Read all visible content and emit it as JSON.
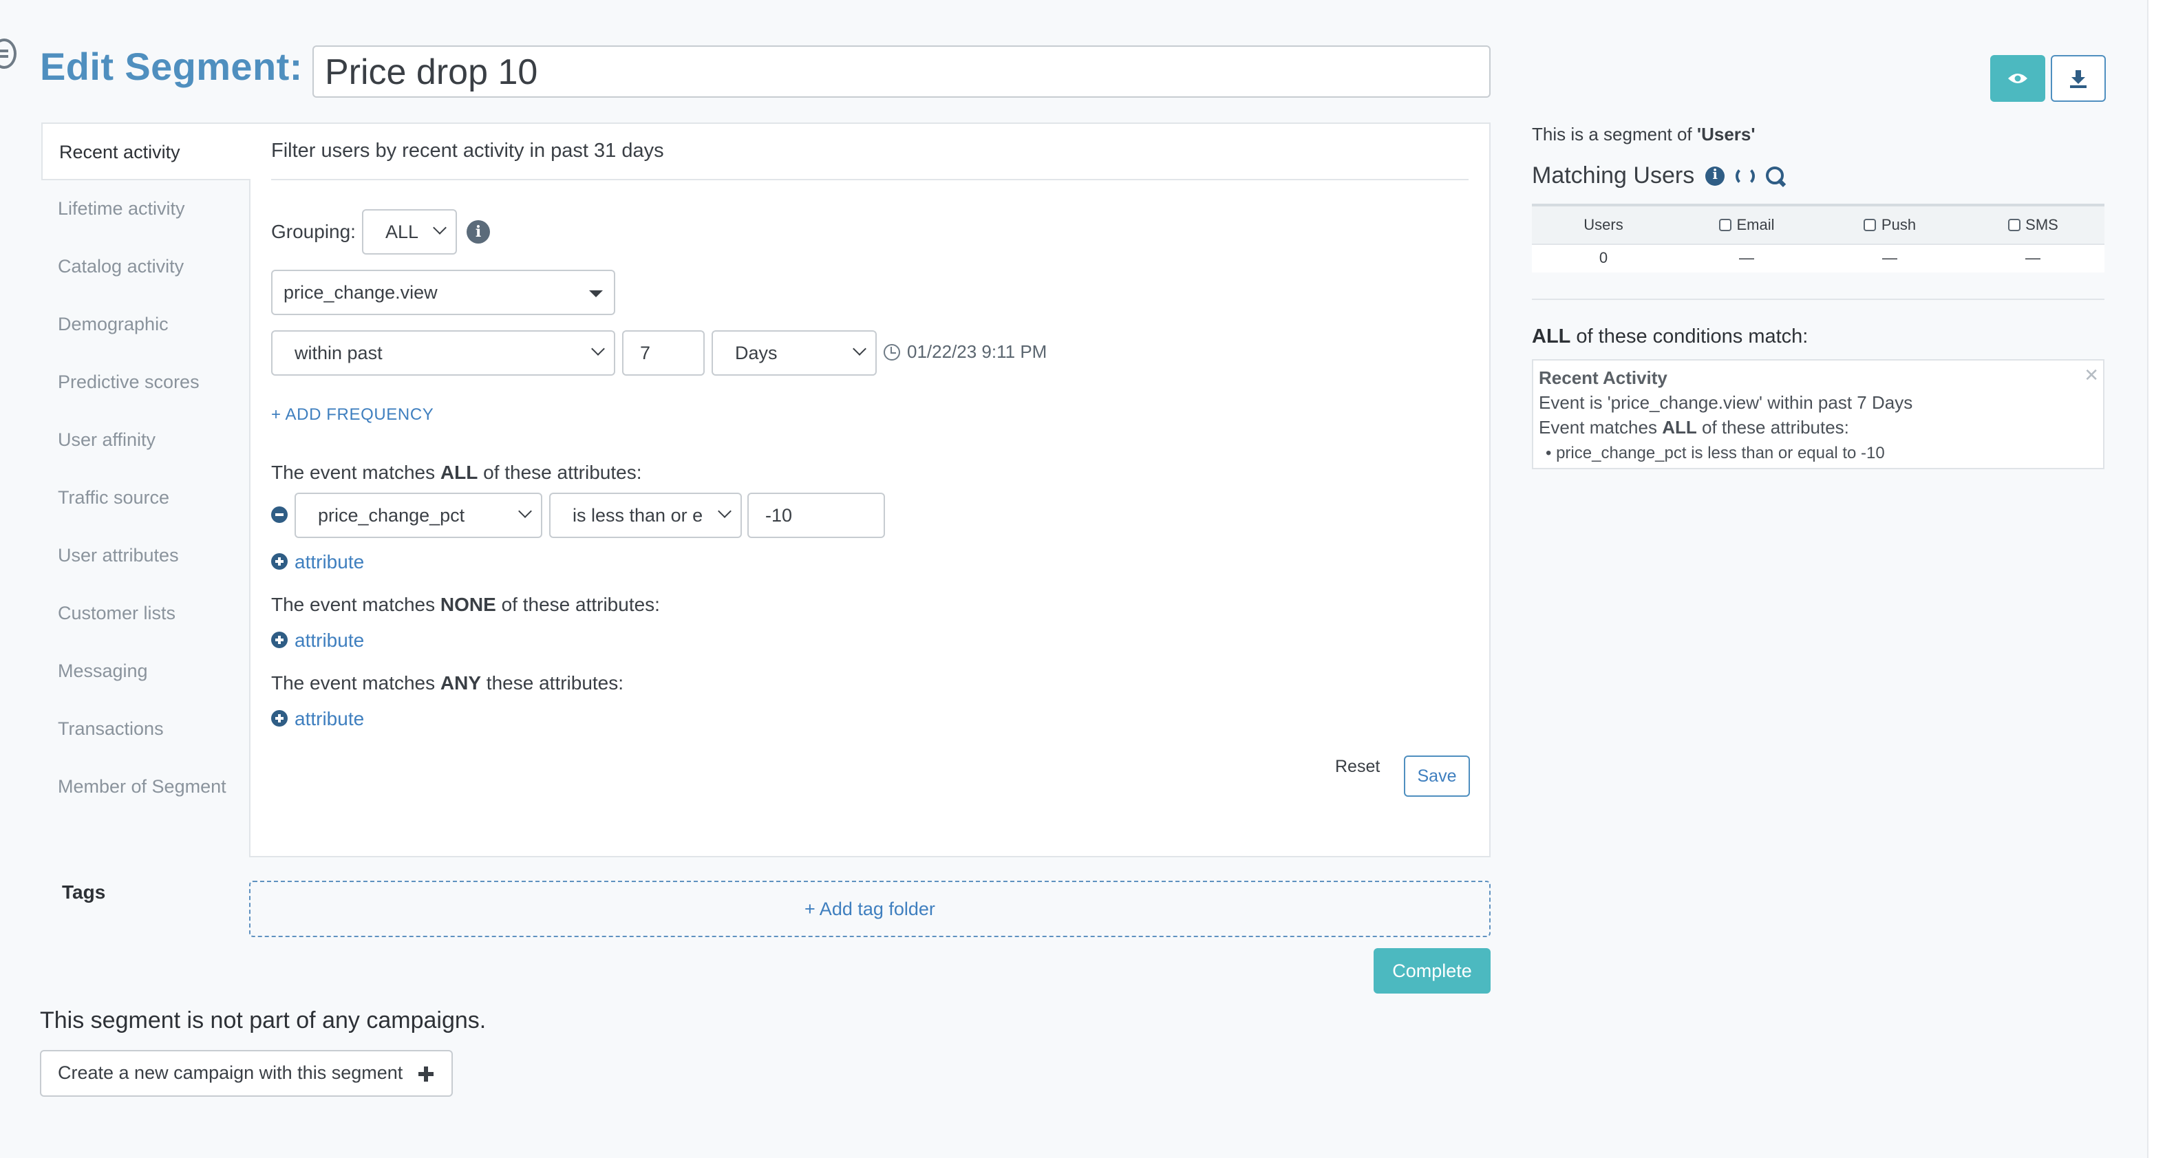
{
  "header": {
    "title_prefix": "Edit Segment:",
    "segment_name": "Price drop 10"
  },
  "sidebar": {
    "items": [
      {
        "label": "Recent activity",
        "active": true
      },
      {
        "label": "Lifetime activity"
      },
      {
        "label": "Catalog activity"
      },
      {
        "label": "Demographic"
      },
      {
        "label": "Predictive scores"
      },
      {
        "label": "User affinity"
      },
      {
        "label": "Traffic source"
      },
      {
        "label": "User attributes"
      },
      {
        "label": "Customer lists"
      },
      {
        "label": "Messaging"
      },
      {
        "label": "Transactions"
      },
      {
        "label": "Member of Segment"
      }
    ]
  },
  "panel": {
    "heading": "Filter users by recent activity in past 31 days",
    "grouping_label": "Grouping:",
    "grouping_value": "ALL",
    "event_value": "price_change.view",
    "range_value": "within past",
    "range_number": "7",
    "range_unit": "Days",
    "timestamp": "01/22/23 9:11 PM",
    "add_frequency": "+ ADD FREQUENCY",
    "all_pre": "The event matches ",
    "all_bold": "ALL",
    "all_post": " of these attributes:",
    "attr_field": "price_change_pct",
    "attr_operator": "is less than or e",
    "attr_value": "-10",
    "attribute_link": "attribute",
    "none_pre": "The event matches ",
    "none_bold": "NONE",
    "none_post": " of these attributes:",
    "any_pre": "The event matches ",
    "any_bold": "ANY",
    "any_post": " these attributes:",
    "reset": "Reset",
    "save": "Save"
  },
  "tags": {
    "label": "Tags",
    "add_folder": "+ Add tag folder"
  },
  "complete": "Complete",
  "campaigns": {
    "text": "This segment is not part of any campaigns.",
    "create_button": "Create a new campaign with this segment"
  },
  "right": {
    "segment_of_pre": "This is a segment of ",
    "segment_of_bold": "'Users'",
    "matching_users": "Matching Users",
    "columns": [
      "Users",
      "Email",
      "Push",
      "SMS"
    ],
    "values": [
      "0",
      "—",
      "—",
      "—"
    ],
    "conditions_bold": "ALL",
    "conditions_post": " of these conditions match:",
    "cond_heading": "Recent Activity",
    "cond_line1": "Event is 'price_change.view' within past 7 Days",
    "cond_line2_pre": "Event matches ",
    "cond_line2_bold": "ALL",
    "cond_line2_post": " of these attributes:",
    "cond_bullet": "• price_change_pct is less than or equal to -10",
    "close": "✕"
  },
  "colors": {
    "accent": "#4cb9c0",
    "title": "#4f8fbf",
    "link": "#3f7fbf"
  },
  "icons": [
    "preview-eye-icon",
    "download-icon",
    "info-icon",
    "clock-icon",
    "refresh-icon",
    "search-icon",
    "plus-circle-icon",
    "minus-circle-icon",
    "close-icon"
  ]
}
